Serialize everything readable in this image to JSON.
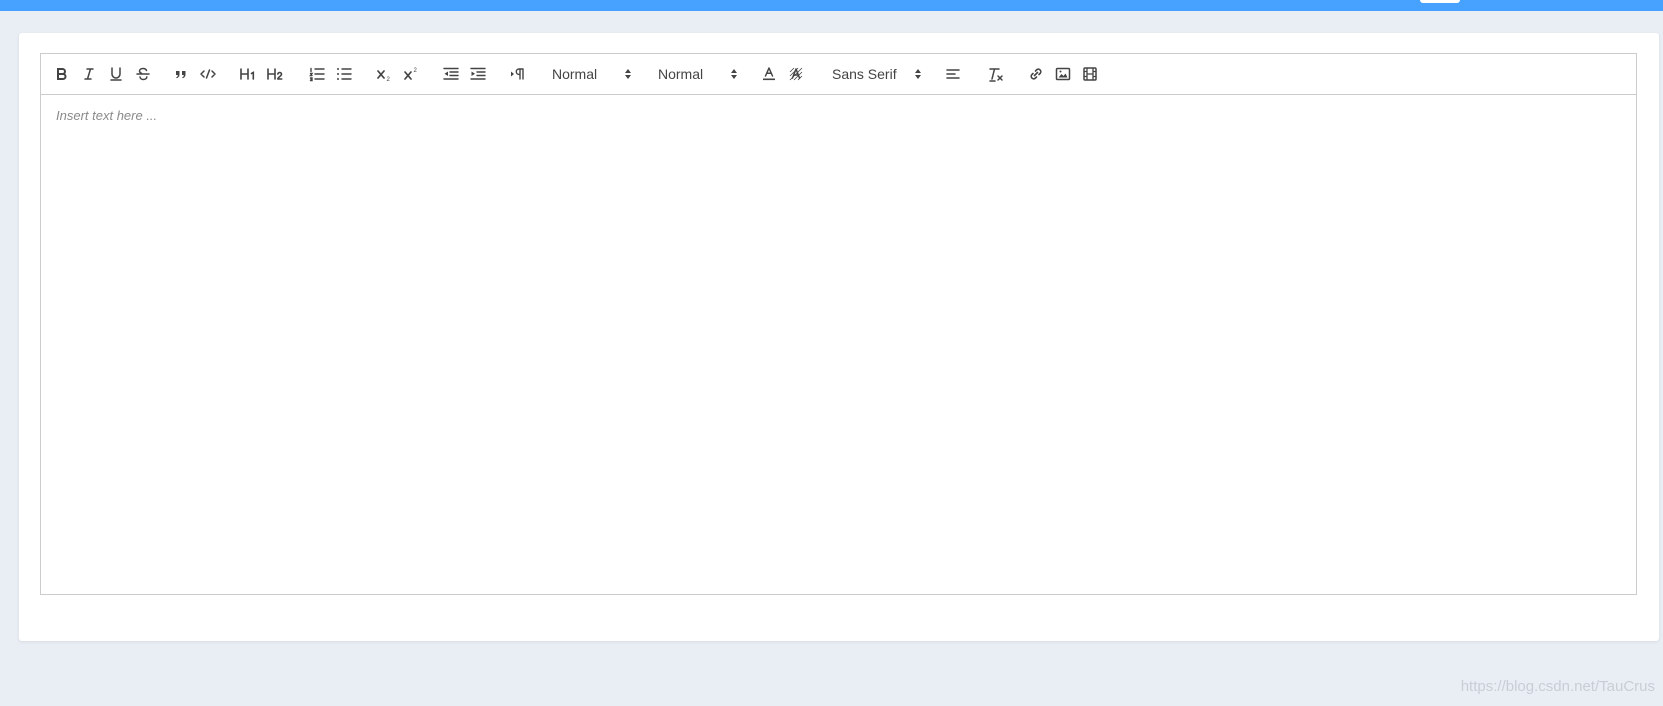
{
  "editor": {
    "placeholder": "Insert text here ...",
    "toolbar": {
      "header_select": "Normal",
      "size_select": "Normal",
      "font_select": "Sans Serif"
    },
    "icons": {
      "bold": "bold-icon",
      "italic": "italic-icon",
      "underline": "underline-icon",
      "strike": "strikethrough-icon",
      "blockquote": "blockquote-icon",
      "code_block": "code-block-icon",
      "h1": "header-1-icon",
      "h2": "header-2-icon",
      "ordered_list": "ordered-list-icon",
      "bullet_list": "bullet-list-icon",
      "subscript": "subscript-icon",
      "superscript": "superscript-icon",
      "outdent": "outdent-icon",
      "indent": "indent-icon",
      "direction": "text-direction-rtl-icon",
      "text_color": "text-color-icon",
      "background_color": "background-color-icon",
      "align": "align-left-icon",
      "clean": "clear-formatting-icon",
      "link": "link-icon",
      "image": "image-icon",
      "video": "video-icon"
    }
  },
  "watermark": "https://blog.csdn.net/TauCrus",
  "colors": {
    "topbar": "#46a1ff",
    "background": "#e9edf4",
    "icon": "#444444"
  }
}
